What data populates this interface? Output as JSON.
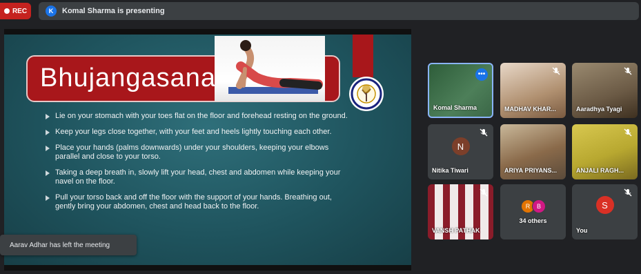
{
  "top_bar": {
    "rec_label": "REC",
    "presenter_initial": "K",
    "presenting_text": "Komal Sharma is presenting"
  },
  "slide": {
    "title": "Bhujangasana",
    "logo_text": "STEP UP SCHOOL",
    "bullets": [
      "Lie on your stomach with your toes flat on the floor and forehead resting on the ground.",
      "Keep your legs close together, with your feet and heels lightly touching each other.",
      "Place your hands (palms downwards) under your shoulders, keeping your elbows parallel and close to your torso.",
      "Taking a deep breath in, slowly lift your head, chest and abdomen while keeping your navel on the floor.",
      "Pull your torso back and off the floor with the support of your hands. Breathing out, gently bring your abdomen, chest and head back to the floor."
    ]
  },
  "toast": {
    "text": "Aarav Adhar has left the meeting"
  },
  "participants": [
    {
      "name": "Komal Sharma"
    },
    {
      "name": "MADHAV KHAR..."
    },
    {
      "name": "Aaradhya Tyagi"
    },
    {
      "name": "Nitika Tiwari",
      "initial": "N"
    },
    {
      "name": "ARIYA PRIYANS..."
    },
    {
      "name": "ANJALI RAGH..."
    },
    {
      "name": "VANSH PATHAK"
    },
    {
      "name": "34 others",
      "avatars": [
        "R",
        "B"
      ]
    },
    {
      "name": "You",
      "initial": "S"
    }
  ],
  "colors": {
    "accent_red": "#a8171b",
    "rec_red": "#c5221f",
    "tile_bg": "#3c4043",
    "active_border": "#8ab4f8"
  },
  "icons": [
    "record-dot-icon",
    "mic-off-icon",
    "more-options-icon",
    "bullet-arrow-icon"
  ]
}
